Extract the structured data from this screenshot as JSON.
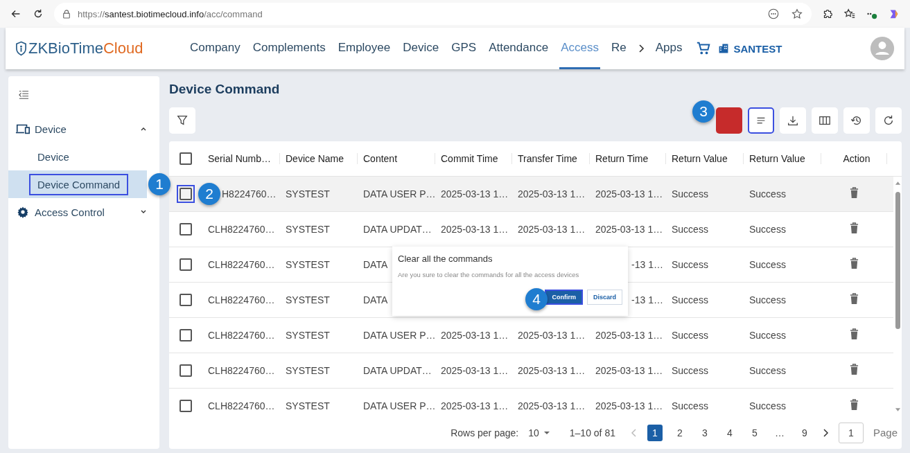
{
  "browser": {
    "url_scheme": "https://",
    "url_host": "santest.biotimecloud.info",
    "url_path": "/acc/command"
  },
  "header": {
    "logo_primary": "ZKBioTime",
    "logo_accent": "Cloud",
    "nav": [
      {
        "label": "Company",
        "selected": false
      },
      {
        "label": "Complements",
        "selected": false
      },
      {
        "label": "Employee",
        "selected": false
      },
      {
        "label": "Device",
        "selected": false
      },
      {
        "label": "GPS",
        "selected": false
      },
      {
        "label": "Attendance",
        "selected": false
      },
      {
        "label": "Access",
        "selected": true
      },
      {
        "label": "Re",
        "selected": false
      }
    ],
    "apps": "Apps",
    "company": "SANTEST"
  },
  "sidebar": {
    "groups": [
      {
        "label": "Device",
        "kind": "device",
        "expanded": true,
        "children": [
          {
            "label": "Device",
            "selected": false,
            "outlined": false
          },
          {
            "label": "Device Command",
            "selected": true,
            "outlined": true,
            "callout": "1"
          }
        ]
      },
      {
        "label": "Access Control",
        "kind": "gear",
        "expanded": false
      }
    ]
  },
  "page": {
    "title": "Device Command"
  },
  "toolbar": [
    {
      "kind": "danger",
      "outlined": false,
      "callout": "3"
    },
    {
      "kind": "clear",
      "outlined": true
    },
    {
      "kind": "download",
      "outlined": false
    },
    {
      "kind": "columns",
      "outlined": false
    },
    {
      "kind": "history",
      "outlined": false
    },
    {
      "kind": "refresh",
      "outlined": false
    }
  ],
  "table": {
    "select_all_checked": false,
    "columns": [
      "Serial Numb…",
      "Device Name",
      "Content",
      "Commit Time",
      "Transfer Time",
      "Return Time",
      "Return Value",
      "Return Value",
      "Action"
    ],
    "rows": [
      {
        "highlighted": true,
        "checkbox_outlined": true,
        "callout": "2",
        "cells": [
          "H8224760…",
          "SYSTEST",
          "DATA USER P…",
          "2025-03-13 1…",
          "2025-03-13 1…",
          "2025-03-13 1…",
          "Success",
          "Success"
        ]
      },
      {
        "highlighted": false,
        "checkbox_outlined": false,
        "cells": [
          "CLH8224760…",
          "SYSTEST",
          "DATA UPDAT…",
          "2025-03-13 1…",
          "2025-03-13 1…",
          "2025-03-13 1…",
          "Success",
          "Success"
        ]
      },
      {
        "highlighted": false,
        "checkbox_outlined": false,
        "cells": [
          "CLH8224760…",
          "SYSTEST",
          "DATA",
          null,
          null,
          "-13 1…",
          "Success",
          "Success"
        ]
      },
      {
        "highlighted": false,
        "checkbox_outlined": false,
        "cells": [
          "CLH8224760…",
          "SYSTEST",
          "DATA",
          null,
          null,
          "-13 1…",
          "Success",
          "Success"
        ]
      },
      {
        "highlighted": false,
        "checkbox_outlined": false,
        "cells": [
          "CLH8224760…",
          "SYSTEST",
          "DATA USER P…",
          "2025-03-13 1…",
          "2025-03-13 1…",
          "2025-03-13 1…",
          "Success",
          "Success"
        ]
      },
      {
        "highlighted": false,
        "checkbox_outlined": false,
        "cells": [
          "CLH8224760…",
          "SYSTEST",
          "DATA UPDAT…",
          "2025-03-13 1…",
          "2025-03-13 1…",
          "2025-03-13 1…",
          "Success",
          "Success"
        ]
      },
      {
        "highlighted": false,
        "checkbox_outlined": false,
        "cells": [
          "CLH8224760…",
          "SYSTEST",
          "DATA USER P…",
          "2025-03-13 1…",
          "2025-03-13 1…",
          "2025-03-13 1…",
          "Success",
          "Success"
        ]
      }
    ]
  },
  "popover": {
    "title": "Clear all the commands",
    "message": "Are you sure to clear the commands for all the access devices",
    "confirm": {
      "label": "Confirm",
      "outlined": true,
      "callout": "4"
    },
    "discard": "Discard"
  },
  "pagination": {
    "rows_label": "Rows per page:",
    "rows_value": "10",
    "range": "1–10 of 81",
    "pages": [
      {
        "label": "1",
        "selected": true
      },
      {
        "label": "2",
        "selected": false
      },
      {
        "label": "3",
        "selected": false
      },
      {
        "label": "4",
        "selected": false
      },
      {
        "label": "5",
        "selected": false
      },
      {
        "label": "…",
        "selected": false
      },
      {
        "label": "9",
        "selected": false
      }
    ],
    "page_input": "1",
    "page_label": "Page"
  }
}
